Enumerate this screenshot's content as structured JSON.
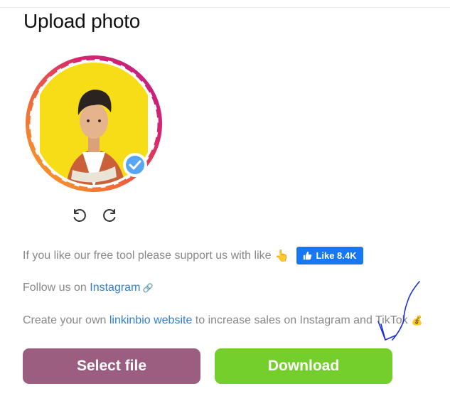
{
  "page": {
    "title": "Upload photo"
  },
  "rotate": {
    "left_icon": "rotate-left-icon",
    "right_icon": "rotate-right-icon"
  },
  "support": {
    "text": "If you like our free tool please support us with like",
    "emoji": "👆",
    "like_button": "Like 8.4K"
  },
  "follow": {
    "prefix": "Follow us on ",
    "link": "Instagram",
    "suffix": " 🔗"
  },
  "promo": {
    "prefix": "Create your own ",
    "link": "linkinbio website",
    "suffix": " to increase sales on Instagram and TikTok",
    "emoji": "💰"
  },
  "buttons": {
    "select_file": "Select file",
    "download": "Download"
  },
  "colors": {
    "select_button": "#9b5e80",
    "download_button": "#74cf2c",
    "link": "#2f7fd0",
    "like_button": "#1877f2"
  }
}
